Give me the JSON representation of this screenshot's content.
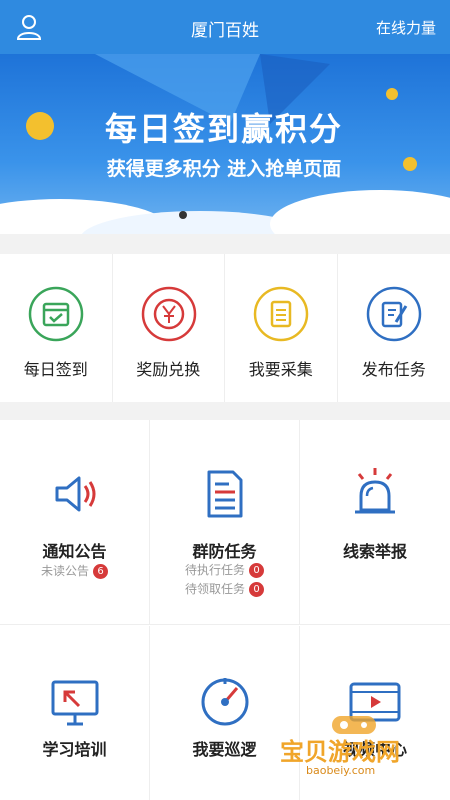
{
  "header": {
    "title": "厦门百姓",
    "right_label": "在线力量"
  },
  "banner": {
    "title": "每日签到赢积分",
    "subtitle": "获得更多积分 进入抢单页面"
  },
  "quick_actions": [
    {
      "label": "每日签到",
      "icon": "calendar-check-icon",
      "color": "#3aa55a"
    },
    {
      "label": "奖励兑换",
      "icon": "yen-coin-icon",
      "color": "#d63a3a"
    },
    {
      "label": "我要采集",
      "icon": "clipboard-icon",
      "color": "#e8b923"
    },
    {
      "label": "发布任务",
      "icon": "edit-document-icon",
      "color": "#2f6fc2"
    }
  ],
  "grid": {
    "notice": {
      "label": "通知公告",
      "sub": "未读公告",
      "badge": "6",
      "icon": "speaker-icon"
    },
    "group_task": {
      "label": "群防任务",
      "sub1": "待执行任务",
      "badge1": "0",
      "sub2": "待领取任务",
      "badge2": "0",
      "icon": "document-lines-icon"
    },
    "report": {
      "label": "线索举报",
      "icon": "alarm-light-icon"
    },
    "training": {
      "label": "学习培训",
      "icon": "monitor-arrow-icon"
    },
    "patrol": {
      "label": "我要巡逻",
      "icon": "compass-icon"
    },
    "video": {
      "label": "视频中心",
      "icon": "video-film-icon"
    }
  },
  "watermark": {
    "text": "宝贝游戏网",
    "url": "baobeiy.com"
  },
  "colors": {
    "header": "#2f8ae0",
    "accent_blue": "#2f6fc2",
    "accent_red": "#d63a3a"
  }
}
